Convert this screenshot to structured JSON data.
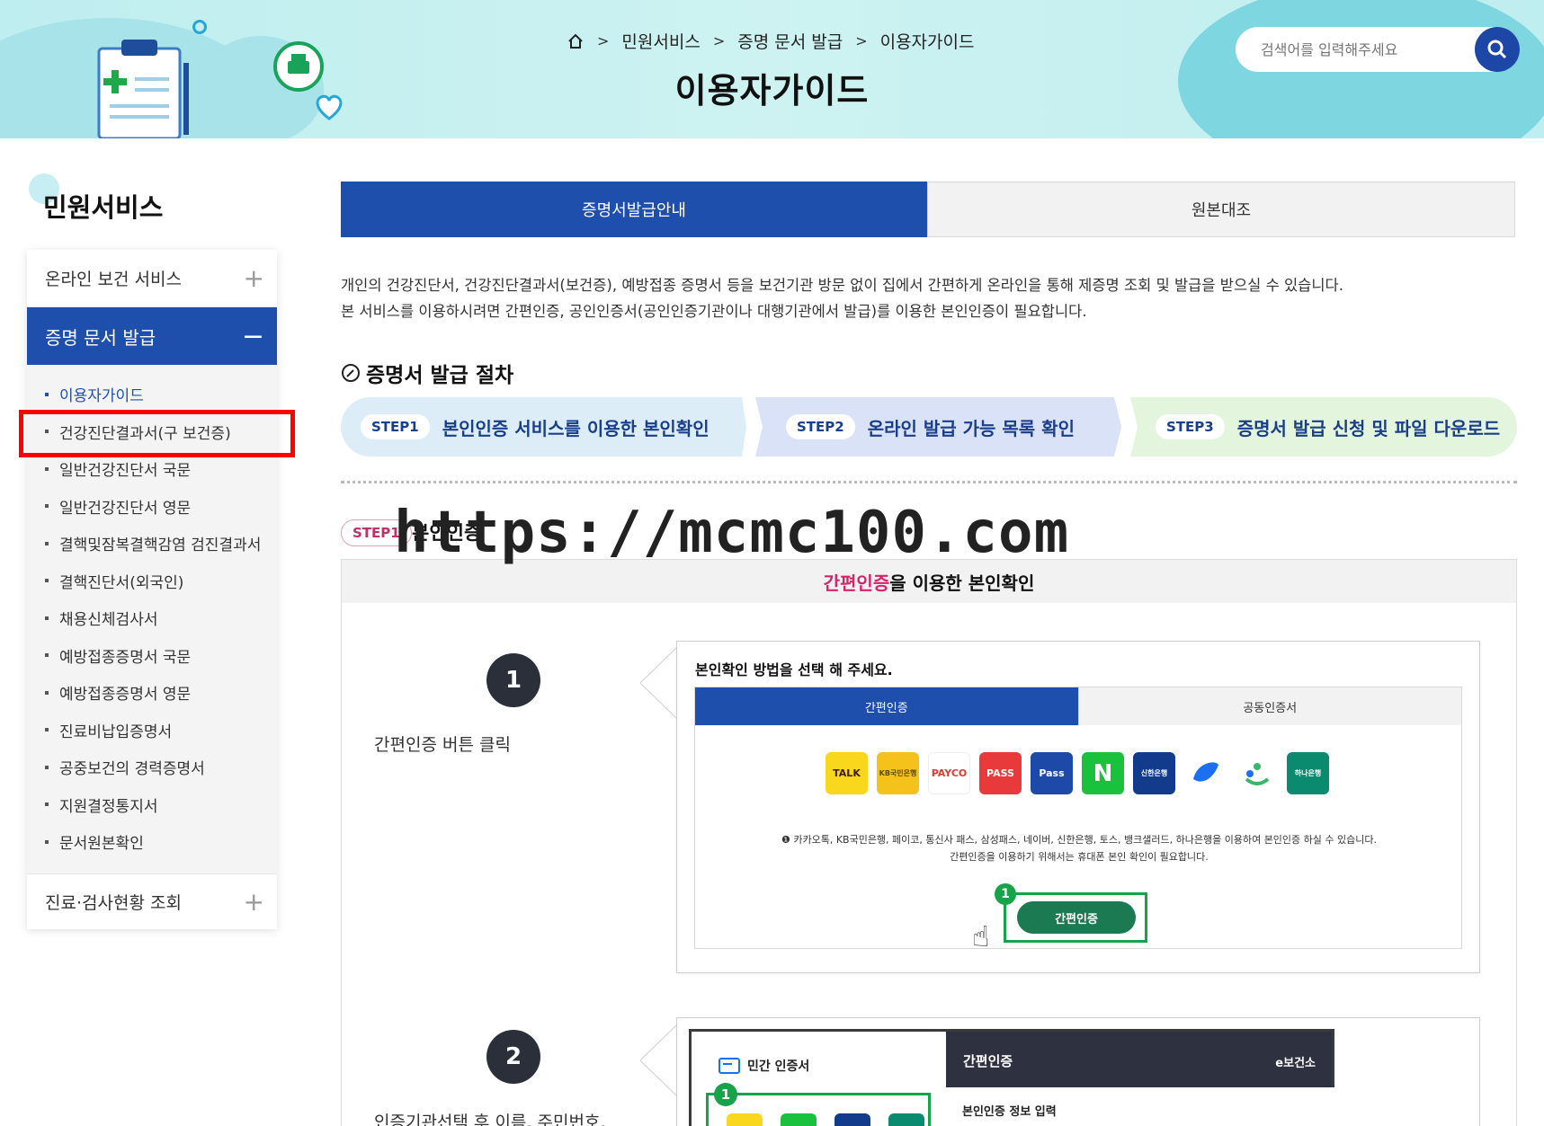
{
  "header": {
    "breadcrumb": [
      "민원서비스",
      "증명 문서 발급",
      "이용자가이드"
    ],
    "page_title": "이용자가이드",
    "search_placeholder": "검색어를 입력해주세요"
  },
  "sidebar": {
    "title": "민원서비스",
    "top_item": "온라인 보건 서비스",
    "active_item": "증명 문서 발급",
    "sub_items": [
      "이용자가이드",
      "건강진단결과서(구 보건증)",
      "일반건강진단서 국문",
      "일반건강진단서 영문",
      "결핵및잠복결핵감염 검진결과서",
      "결핵진단서(외국인)",
      "채용신체검사서",
      "예방접종증명서 국문",
      "예방접종증명서 영문",
      "진료비납입증명서",
      "공중보건의 경력증명서",
      "지원결정통지서",
      "문서원본확인"
    ],
    "bottom_item": "진료·검사현황 조회"
  },
  "tabs": [
    "증명서발급안내",
    "원본대조"
  ],
  "intro": [
    "개인의 건강진단서, 건강진단결과서(보건증), 예방접종 증명서 등을 보건기관 방문 없이 집에서 간편하게 온라인을 통해 제증명 조회 및 발급을 받으실 수 있습니다.",
    "본 서비스를 이용하시려면 간편인증, 공인인증서(공인인증기관이나 대행기관에서 발급)를 이용한 본인인증이 필요합니다."
  ],
  "procedure": {
    "title": "증명서 발급 절차",
    "steps": [
      {
        "badge": "STEP1",
        "label": "본인인증 서비스를 이용한 본인확인",
        "color": "#dcedf8"
      },
      {
        "badge": "STEP2",
        "label": "온라인 발급 가능 목록 확인",
        "color": "#d9e2f7"
      },
      {
        "badge": "STEP3",
        "label": "증명서 발급 신청 및 파일 다운로드",
        "color": "#e4f5dd"
      }
    ]
  },
  "section1": {
    "badge": "STEP1",
    "label": "본인인증",
    "watermark": "https://mcmc100.com",
    "heading_pink": "간편인증",
    "heading_rest": "을 이용한 본인확인"
  },
  "guide1": {
    "num": "1",
    "desc": "간편인증 버튼 클릭",
    "mock_title": "본인확인 방법을 선택 해 주세요.",
    "tab_a": "간편인증",
    "tab_b": "공동인증서",
    "icons": [
      {
        "label": "TALK",
        "bg": "#f9d71c",
        "fg": "#3c1e1e"
      },
      {
        "label": "KB국민은행",
        "bg": "#f4c21a",
        "fg": "#5a4a00"
      },
      {
        "label": "PAYCO",
        "bg": "#ffffff",
        "fg": "#e23b30"
      },
      {
        "label": "PASS",
        "bg": "#e83a3a",
        "fg": "#ffffff"
      },
      {
        "label": "Pass",
        "bg": "#1d4aa8",
        "fg": "#ffffff"
      },
      {
        "label": "N",
        "bg": "#19c13c",
        "fg": "#ffffff"
      },
      {
        "label": "신한은행",
        "bg": "#123b8c",
        "fg": "#ffffff"
      },
      {
        "label": "",
        "bg": "#ffffff",
        "fg": "#1d6ff2"
      },
      {
        "label": "",
        "bg": "#ffffff",
        "fg": "#3bb56a"
      },
      {
        "label": "하나은행",
        "bg": "#0a8a6e",
        "fg": "#ffffff"
      }
    ],
    "note1": "카카오톡, KB국민은행, 페이코, 통신사 패스, 삼성패스, 네이버, 신한은행, 토스, 뱅크샐러드, 하나은행을 이용하여 본인인증 하실 수 있습니다.",
    "note2": "간편인증을 이용하기 위해서는 휴대폰 본인 확인이 필요합니다.",
    "button": "간편인증",
    "badge": "1"
  },
  "guide2": {
    "num": "2",
    "desc": "인증기관선택 후 이름, 주민번호,",
    "left_title": "민간 인증서",
    "right_title": "간편인증",
    "brand": "e보건소",
    "sub": "본인인증 정보 입력",
    "badge": "1"
  }
}
